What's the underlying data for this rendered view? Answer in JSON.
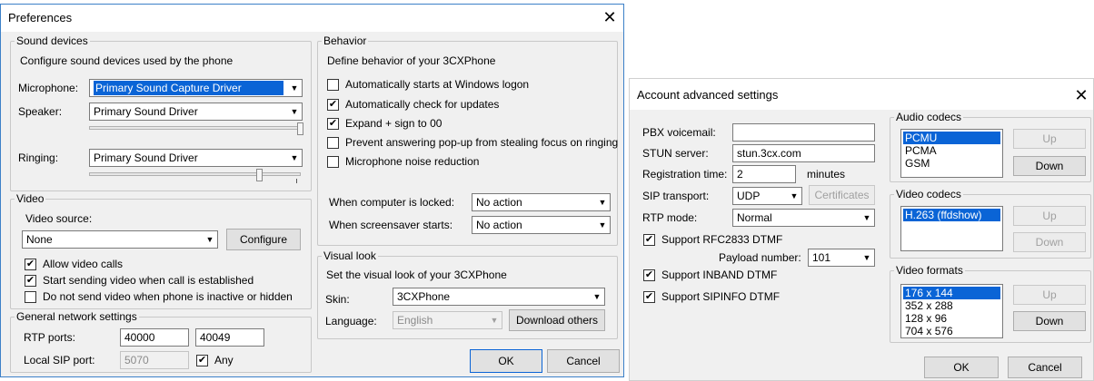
{
  "prefs": {
    "title": "Preferences",
    "close": "✕",
    "sound": {
      "legend": "Sound devices",
      "desc": "Configure sound devices used by the phone",
      "mic_label": "Microphone:",
      "mic_value": "Primary Sound Capture Driver",
      "speaker_label": "Speaker:",
      "speaker_value": "Primary Sound Driver",
      "ringing_label": "Ringing:",
      "ringing_value": "Primary Sound Driver"
    },
    "video": {
      "legend": "Video",
      "source_label": "Video source:",
      "source_value": "None",
      "configure": "Configure",
      "allow": "Allow video calls",
      "allow_checked": true,
      "start": "Start sending video when call is established",
      "start_checked": true,
      "donot": "Do not send video when phone is inactive or hidden",
      "donot_checked": false
    },
    "network": {
      "legend": "General network settings",
      "rtp_label": "RTP ports:",
      "rtp_from": "40000",
      "rtp_to": "40049",
      "sip_label": "Local SIP port:",
      "sip_value": "5070",
      "any": "Any",
      "any_checked": true
    },
    "behavior": {
      "legend": "Behavior",
      "desc": "Define behavior of your 3CXPhone",
      "opt1": "Automatically starts at Windows logon",
      "opt1_checked": false,
      "opt2": "Automatically check for updates",
      "opt2_checked": true,
      "opt3": "Expand + sign to 00",
      "opt3_checked": true,
      "opt4": "Prevent answering pop-up from stealing focus on ringing",
      "opt4_checked": false,
      "opt5": "Microphone noise reduction",
      "opt5_checked": false,
      "locked_label": "When computer is locked:",
      "locked_value": "No action",
      "saver_label": "When screensaver starts:",
      "saver_value": "No action"
    },
    "visual": {
      "legend": "Visual look",
      "desc": "Set the visual look of your 3CXPhone",
      "skin_label": "Skin:",
      "skin_value": "3CXPhone",
      "lang_label": "Language:",
      "lang_value": "English",
      "download": "Download others"
    },
    "ok": "OK",
    "cancel": "Cancel"
  },
  "adv": {
    "title": "Account advanced settings",
    "close": "✕",
    "pbx_label": "PBX voicemail:",
    "pbx_value": "",
    "stun_label": "STUN server:",
    "stun_value": "stun.3cx.com",
    "reg_label": "Registration time:",
    "reg_value": "2",
    "reg_unit": "minutes",
    "sip_label": "SIP transport:",
    "sip_value": "UDP",
    "certs": "Certificates",
    "rtp_label": "RTP mode:",
    "rtp_value": "Normal",
    "rfc": "Support RFC2833 DTMF",
    "rfc_checked": true,
    "payload_label": "Payload number:",
    "payload_value": "101",
    "inband": "Support INBAND DTMF",
    "inband_checked": true,
    "sipinfo": "Support SIPINFO DTMF",
    "sipinfo_checked": true,
    "audio": {
      "legend": "Audio codecs",
      "items": [
        "PCMU",
        "PCMA",
        "GSM"
      ],
      "up": "Up",
      "down": "Down"
    },
    "vcodec": {
      "legend": "Video codecs",
      "items": [
        "H.263 (ffdshow)"
      ],
      "up": "Up",
      "down": "Down"
    },
    "vformat": {
      "legend": "Video formats",
      "items": [
        "176 x 144",
        "352 x 288",
        "128 x 96",
        "704 x 576"
      ],
      "up": "Up",
      "down": "Down"
    },
    "ok": "OK",
    "cancel": "Cancel"
  },
  "colors": {
    "accent": "#0a64d6",
    "border": "#3c80c8"
  },
  "icons": {
    "check": "check-icon",
    "dropdown": "chevron-down-icon",
    "close": "close-icon"
  }
}
